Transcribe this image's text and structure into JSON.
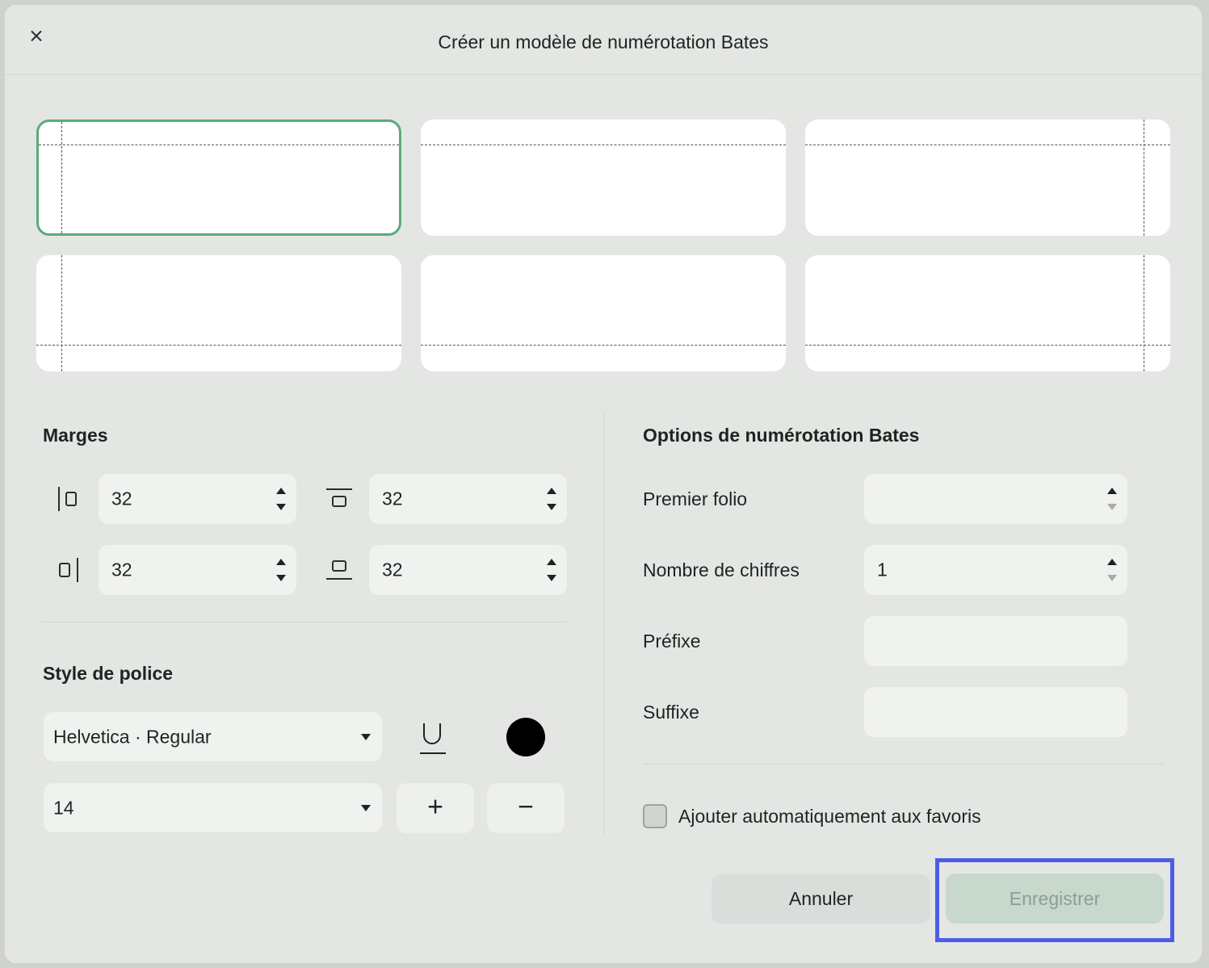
{
  "dialog": {
    "title": "Créer un modèle de numérotation Bates",
    "close_icon": "close-icon"
  },
  "position_cards": [
    {
      "name": "top-left",
      "selected": true
    },
    {
      "name": "top-center",
      "selected": false
    },
    {
      "name": "top-right",
      "selected": false
    },
    {
      "name": "bottom-left",
      "selected": false
    },
    {
      "name": "bottom-center",
      "selected": false
    },
    {
      "name": "bottom-right",
      "selected": false
    }
  ],
  "margins": {
    "title": "Marges",
    "left": "32",
    "top": "32",
    "right": "32",
    "bottom": "32"
  },
  "font_style": {
    "title": "Style de police",
    "font": "Helvetica · Regular",
    "size": "14",
    "increase_label": "+",
    "decrease_label": "−",
    "color": "#000000"
  },
  "bates_options": {
    "title": "Options de numérotation Bates",
    "first_folio_label": "Premier folio",
    "first_folio_value": "",
    "digits_label": "Nombre de chiffres",
    "digits_value": "1",
    "prefix_label": "Préfixe",
    "prefix_value": "",
    "suffix_label": "Suffixe",
    "suffix_value": "",
    "favorites_label": "Ajouter automatiquement aux favoris",
    "favorites_checked": false
  },
  "actions": {
    "cancel_label": "Annuler",
    "save_label": "Enregistrer"
  },
  "colors": {
    "accent_selected": "#5aab7c",
    "highlight": "#4a5ee8"
  }
}
